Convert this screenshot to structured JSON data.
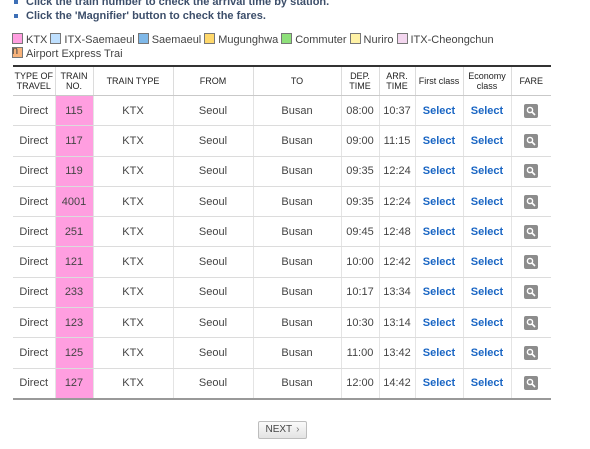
{
  "notes": [
    "Click the train number to check the arrival time by station.",
    "Click the 'Magnifier' button to check the fares."
  ],
  "legend": [
    {
      "label": "KTX",
      "color": "#ff9ee0"
    },
    {
      "label": "ITX-Saemaeul",
      "color": "#bfe0ff"
    },
    {
      "label": "Saemaeul",
      "color": "#7fb8e8"
    },
    {
      "label": "Mugunghwa",
      "color": "#ffd86b"
    },
    {
      "label": "Commuter",
      "color": "#8ee07a"
    },
    {
      "label": "Nuriro",
      "color": "#fff2a6"
    },
    {
      "label": "ITX-Cheongchun",
      "color": "#f3d6ef"
    },
    {
      "label": "Airport Express Trai",
      "color": "#f7b27a"
    }
  ],
  "legend_wrap": "n",
  "table": {
    "headers": {
      "type_line1": "TYPE OF",
      "type_line2": "TRAVEL",
      "no_line1": "TRAIN",
      "no_line2": "NO.",
      "train_type": "TRAIN TYPE",
      "from": "FROM",
      "to": "TO",
      "dep_line1": "DEP.",
      "dep_line2": "TIME",
      "arr_line1": "ARR.",
      "arr_line2": "TIME",
      "first_class": "First class",
      "econ_line1": "Economy",
      "econ_line2": "class",
      "fare": "FARE"
    },
    "rows": [
      {
        "travel": "Direct",
        "no": "115",
        "type": "KTX",
        "from": "Seoul",
        "to": "Busan",
        "dep": "08:00",
        "arr": "10:37",
        "first": "Select",
        "economy": "Select"
      },
      {
        "travel": "Direct",
        "no": "117",
        "type": "KTX",
        "from": "Seoul",
        "to": "Busan",
        "dep": "09:00",
        "arr": "11:15",
        "first": "Select",
        "economy": "Select"
      },
      {
        "travel": "Direct",
        "no": "119",
        "type": "KTX",
        "from": "Seoul",
        "to": "Busan",
        "dep": "09:35",
        "arr": "12:24",
        "first": "Select",
        "economy": "Select"
      },
      {
        "travel": "Direct",
        "no": "4001",
        "type": "KTX",
        "from": "Seoul",
        "to": "Busan",
        "dep": "09:35",
        "arr": "12:24",
        "first": "Select",
        "economy": "Select"
      },
      {
        "travel": "Direct",
        "no": "251",
        "type": "KTX",
        "from": "Seoul",
        "to": "Busan",
        "dep": "09:45",
        "arr": "12:48",
        "first": "Select",
        "economy": "Select"
      },
      {
        "travel": "Direct",
        "no": "121",
        "type": "KTX",
        "from": "Seoul",
        "to": "Busan",
        "dep": "10:00",
        "arr": "12:42",
        "first": "Select",
        "economy": "Select"
      },
      {
        "travel": "Direct",
        "no": "233",
        "type": "KTX",
        "from": "Seoul",
        "to": "Busan",
        "dep": "10:17",
        "arr": "13:34",
        "first": "Select",
        "economy": "Select"
      },
      {
        "travel": "Direct",
        "no": "123",
        "type": "KTX",
        "from": "Seoul",
        "to": "Busan",
        "dep": "10:30",
        "arr": "13:14",
        "first": "Select",
        "economy": "Select"
      },
      {
        "travel": "Direct",
        "no": "125",
        "type": "KTX",
        "from": "Seoul",
        "to": "Busan",
        "dep": "11:00",
        "arr": "13:42",
        "first": "Select",
        "economy": "Select"
      },
      {
        "travel": "Direct",
        "no": "127",
        "type": "KTX",
        "from": "Seoul",
        "to": "Busan",
        "dep": "12:00",
        "arr": "14:42",
        "first": "Select",
        "economy": "Select"
      }
    ]
  },
  "fare_icon": "magnifier-icon",
  "next_label": "NEXT",
  "next_icon": "chevron-right-icon"
}
